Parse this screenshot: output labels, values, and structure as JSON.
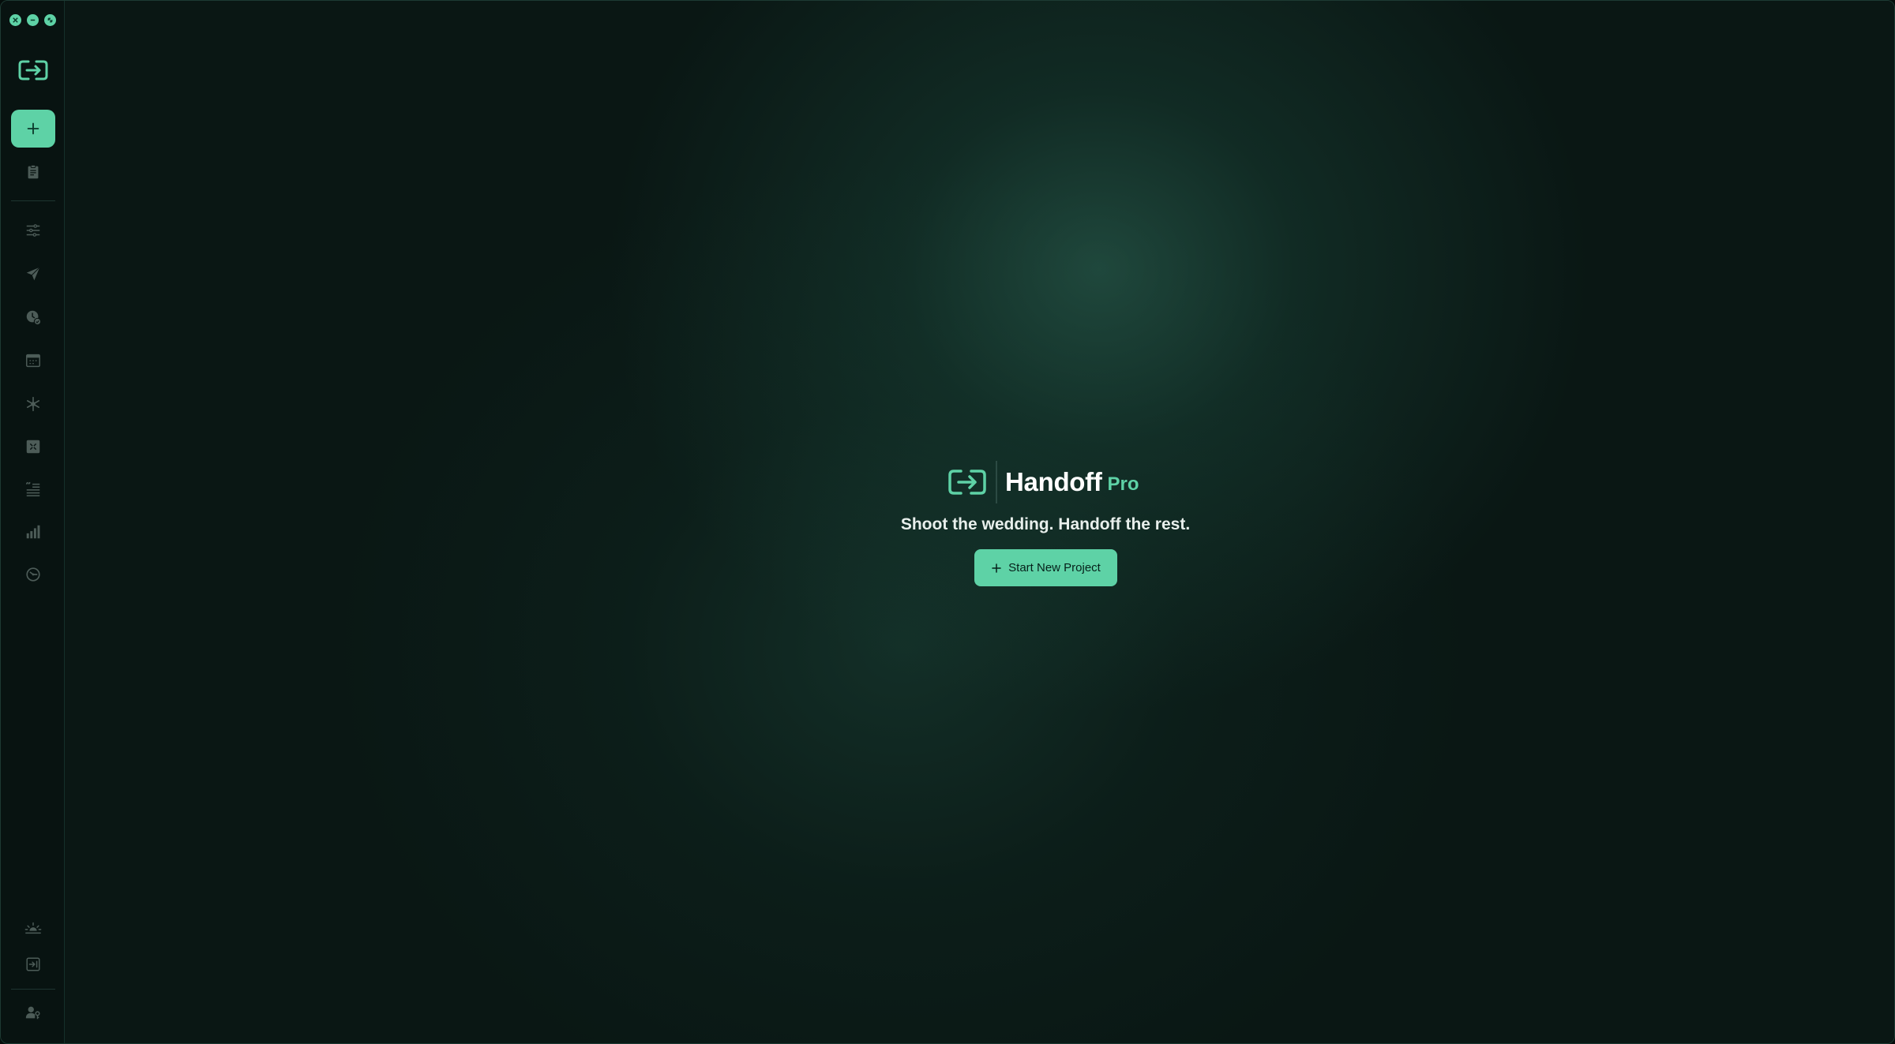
{
  "window": {
    "controls": [
      "close",
      "minimize",
      "zoom"
    ]
  },
  "sidebar": {
    "logo_icon": "handoff-logo-icon",
    "items": [
      {
        "name": "new-project",
        "icon": "plus-icon"
      },
      {
        "name": "clipboard",
        "icon": "clipboard-icon"
      },
      {
        "name": "adjustments",
        "icon": "sliders-icon"
      },
      {
        "name": "send",
        "icon": "paper-plane-icon"
      },
      {
        "name": "schedule",
        "icon": "clock-check-icon"
      },
      {
        "name": "calendar",
        "icon": "calendar-icon"
      },
      {
        "name": "asset",
        "icon": "snowflake-icon"
      },
      {
        "name": "templates",
        "icon": "grid-box-icon"
      },
      {
        "name": "quotes",
        "icon": "quote-list-icon"
      },
      {
        "name": "analytics",
        "icon": "bar-chart-icon"
      },
      {
        "name": "timer",
        "icon": "gauge-icon"
      }
    ],
    "bottom_items": [
      {
        "name": "appearance",
        "icon": "sunrise-icon"
      },
      {
        "name": "import",
        "icon": "import-box-icon"
      },
      {
        "name": "account",
        "icon": "user-key-icon"
      }
    ]
  },
  "hero": {
    "brand_name": "Handoff",
    "brand_tier": "Pro",
    "tagline": "Shoot the wedding. Handoff the rest.",
    "cta_label": "Start New Project"
  },
  "colors": {
    "accent": "#5ed2a6",
    "background": "#0a1714",
    "sidebar": "#081311",
    "icon_muted": "#4d5c58"
  }
}
